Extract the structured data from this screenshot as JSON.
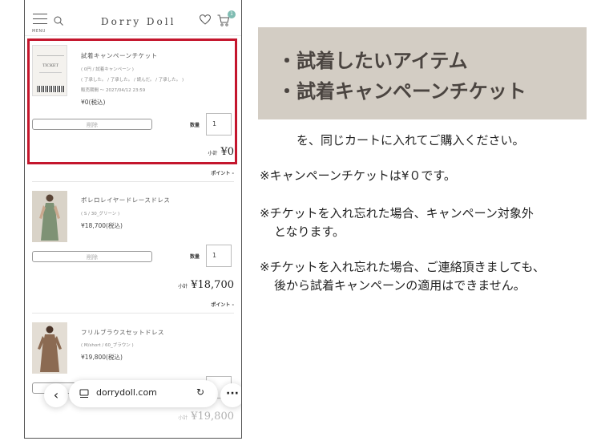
{
  "header": {
    "menu_label": "MENU",
    "brand": "Dorry Doll",
    "cart_count": "1"
  },
  "items": [
    {
      "name": "試着キャンペーンチケット",
      "variant": "( 0円 / 試着キャンペーン )",
      "notes": "( 了承した。 / 了承した。 / 読んだ。 / 了承した。 )",
      "sale_period": "販売期間 ～ 2027/04/12 23:59",
      "price": "¥0(税込)",
      "thumb_text": "TICKET",
      "delete_label": "削除",
      "qty_label": "数量",
      "qty": "1",
      "subtotal_label": "小計",
      "subtotal": "¥0",
      "points_label": "ポイント -"
    },
    {
      "name": "ボレロレイヤードレースドレス",
      "variant": "( S / 30_グリーン )",
      "price": "¥18,700(税込)",
      "delete_label": "削除",
      "qty_label": "数量",
      "qty": "1",
      "subtotal_label": "小計",
      "subtotal": "¥18,700",
      "points_label": "ポイント -"
    },
    {
      "name": "フリルブラウスセットドレス",
      "variant": "( M/short / 60_ブラウン )",
      "price": "¥19,800(税込)",
      "subtotal_label": "小計",
      "subtotal": "¥19,800"
    }
  ],
  "browser": {
    "url": "dorrydoll.com"
  },
  "panel": {
    "line1": "・試着したいアイテム",
    "line2": "・試着キャンペーンチケット"
  },
  "notes": {
    "cart_instruction": "を、同じカートに入れてご購入ください。",
    "ticket_price": "※キャンペーンチケットは¥０です。",
    "forgot_line1": "※チケットを入れ忘れた場合、キャンペーン対象外",
    "forgot_line2": "となります。",
    "contact_line1": "※チケットを入れ忘れた場合、ご連絡頂きましても、",
    "contact_line2": "後から試着キャンペーンの適用はできません。"
  },
  "colors": {
    "highlight": "#c4162d",
    "panel": "#d3cdc4",
    "badge": "#7fbcb2"
  }
}
